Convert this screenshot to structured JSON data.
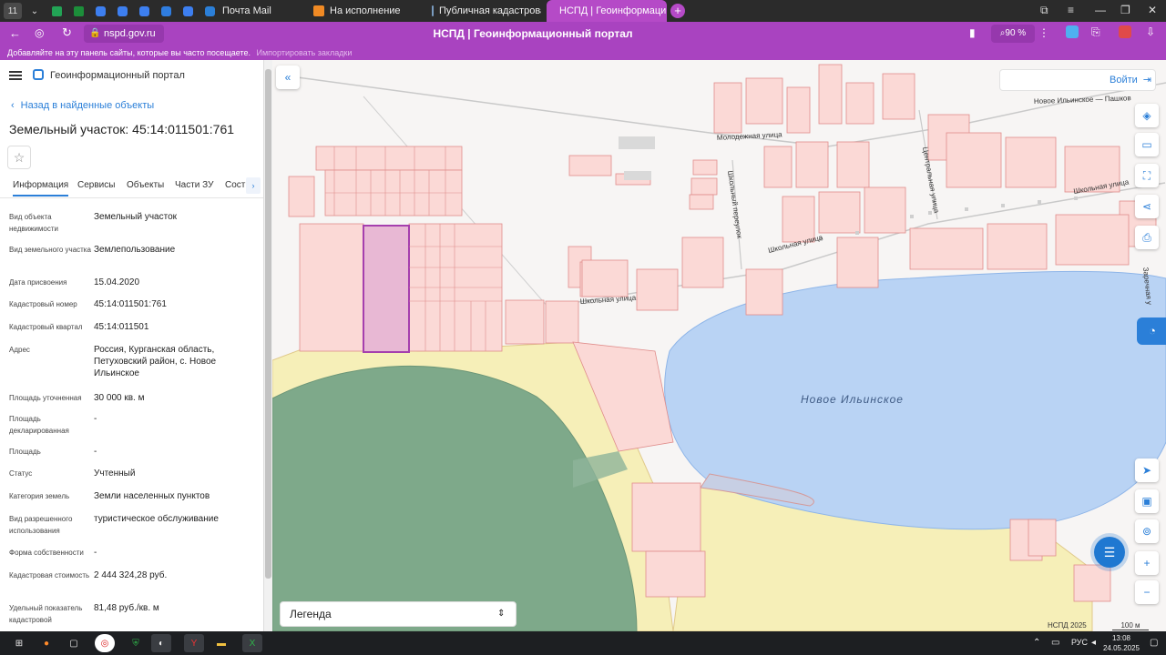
{
  "browser": {
    "tab_counter": "11",
    "tabs": [
      {
        "label": "Почта Mail"
      },
      {
        "label": "На исполнение"
      },
      {
        "label": "Публичная кадастровая"
      },
      {
        "label": "НСПД | Геоинформаци"
      }
    ],
    "url": "nspd.gov.ru",
    "page_title": "НСПД | Геоинформационный портал",
    "zoom": "90 %",
    "bookmark_hint": "Добавляйте на эту панель сайты, которые вы часто посещаете.",
    "bookmark_import": "Импортировать закладки"
  },
  "sidebar": {
    "portal_name": "Геоинформационный портал",
    "back_label": "Назад в найденные объекты",
    "object_title": "Земельный участок: 45:14:011501:761",
    "tabs": [
      "Информация",
      "Сервисы",
      "Объекты",
      "Части ЗУ",
      "Сост"
    ],
    "fields": [
      {
        "label": "Вид объекта недвижимости",
        "value": "Земельный участок"
      },
      {
        "label": "Вид земельного участка",
        "value": "Землепользование"
      },
      {
        "label": "Дата присвоения",
        "value": "15.04.2020"
      },
      {
        "label": "Кадастровый номер",
        "value": "45:14:011501:761"
      },
      {
        "label": "Кадастровый квартал",
        "value": "45:14:011501"
      },
      {
        "label": "Адрес",
        "value": "Россия, Курганская область, Петуховский район, с. Новое Ильинское"
      },
      {
        "label": "Площадь уточненная",
        "value": "30 000 кв. м"
      },
      {
        "label": "Площадь декларированная",
        "value": "-"
      },
      {
        "label": "Площадь",
        "value": "-"
      },
      {
        "label": "Статус",
        "value": "Учтенный"
      },
      {
        "label": "Категория земель",
        "value": "Земли населенных пунктов"
      },
      {
        "label": "Вид разрешенного использования",
        "value": "туристическое обслуживание"
      },
      {
        "label": "Форма собственности",
        "value": "-"
      },
      {
        "label": "Кадастровая стоимость",
        "value": "2 444 324,28 руб."
      },
      {
        "label": "Удельный показатель кадастровой",
        "value": "81,48 руб./кв. м"
      }
    ]
  },
  "map": {
    "login_label": "Войти",
    "lake_name": "Новое Ильинское",
    "streets": {
      "molodezhnaya": "Молодежная улица",
      "shkolnaya1": "Школьная улица",
      "shkolnaya2": "Школьная улица",
      "shkolnaya3": "Школьная улица",
      "tsentralnaya": "Центральная улица",
      "pereulok": "Школьный переулок",
      "zarechnaya": "Заречная у",
      "road": "Новое Ильинское — Пашков"
    },
    "legend_label": "Легенда",
    "attribution": "НСПД 2025",
    "scale": "100 м"
  },
  "taskbar": {
    "lang": "РУС",
    "time": "13:08",
    "date": "24.05.2025"
  }
}
